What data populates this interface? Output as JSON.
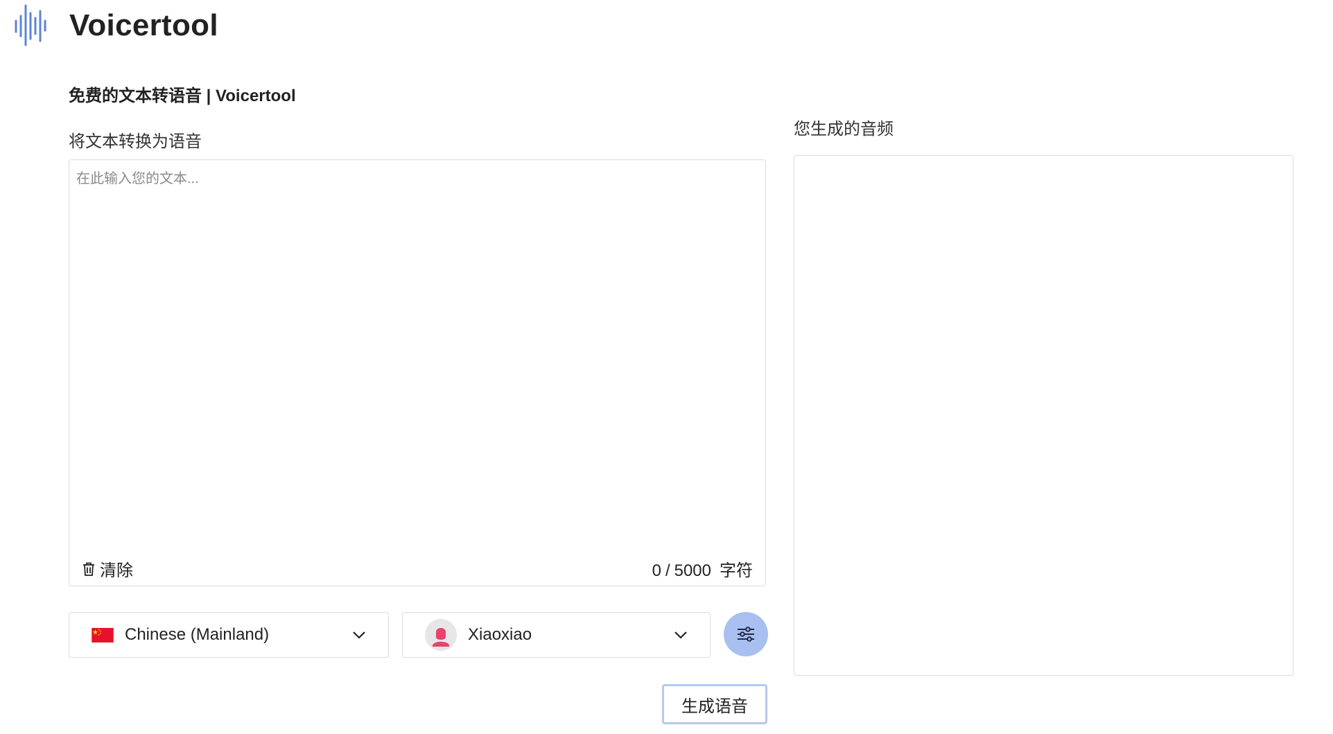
{
  "header": {
    "brand": "Voicertool",
    "logo_icon": "soundwave-icon",
    "logo_color": "#5b84d6"
  },
  "subtitle": "免费的文本转语音 | Voicertool",
  "editor": {
    "label": "将文本转换为语音",
    "placeholder": "在此输入您的文本...",
    "value": "",
    "clear_label": "清除",
    "clear_icon": "trash-icon",
    "char_count": "0",
    "char_max": "5000",
    "char_unit": "字符"
  },
  "language_select": {
    "selected": "Chinese (Mainland)",
    "flag_icon": "china-flag-icon"
  },
  "voice_select": {
    "selected": "Xiaoxiao",
    "avatar_icon": "female-avatar-icon"
  },
  "settings_button": {
    "icon": "sliders-icon",
    "color": "#a9bff0"
  },
  "generate_button": {
    "label": "生成语音",
    "border_color": "#b5c8ef"
  },
  "output": {
    "label": "您生成的音频"
  }
}
